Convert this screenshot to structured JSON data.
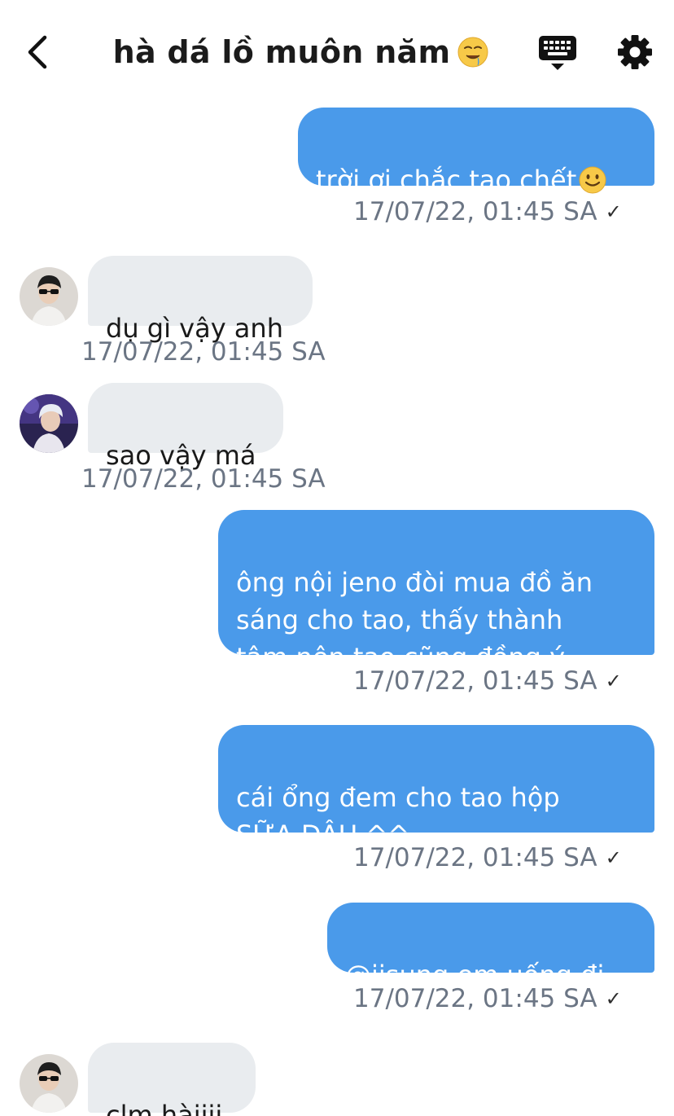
{
  "header": {
    "title": "hà dá lồ muôn năm",
    "title_emoji": "drooling-face-emoji",
    "back_icon": "chevron-left-icon",
    "keyboard_icon": "keyboard-icon",
    "settings_icon": "gear-icon"
  },
  "colors": {
    "outgoing_bubble": "#4a9aea",
    "incoming_bubble": "#e9ecef",
    "timestamp": "#6b7584"
  },
  "messages": [
    {
      "direction": "out",
      "text": "trời ơi chắc tao chết",
      "emoji": "slightly-smiling-face-emoji",
      "timestamp": "17/07/22, 01:45 SA",
      "read": "✓"
    },
    {
      "direction": "in",
      "avatar": "avatar-user-1",
      "text": "dụ gì vậy anh",
      "timestamp": "17/07/22, 01:45 SA"
    },
    {
      "direction": "in",
      "avatar": "avatar-user-2",
      "text": "sao vậy má",
      "timestamp": "17/07/22, 01:45 SA"
    },
    {
      "direction": "out",
      "text": "ông nội jeno đòi mua đồ ăn\nsáng cho tao, thấy thành\ntâm nên tao cũng đồng ý",
      "timestamp": "17/07/22, 01:45 SA",
      "read": "✓"
    },
    {
      "direction": "out",
      "text": "cái ổng đem cho tao hộp\nSỮA DÂU ^^",
      "timestamp": "17/07/22, 01:45 SA",
      "read": "✓"
    },
    {
      "direction": "out",
      "text": "@jisung em uống đi",
      "timestamp": "17/07/22, 01:45 SA",
      "read": "✓"
    },
    {
      "direction": "in",
      "avatar": "avatar-user-1",
      "text": "clm hàiiii"
    }
  ]
}
